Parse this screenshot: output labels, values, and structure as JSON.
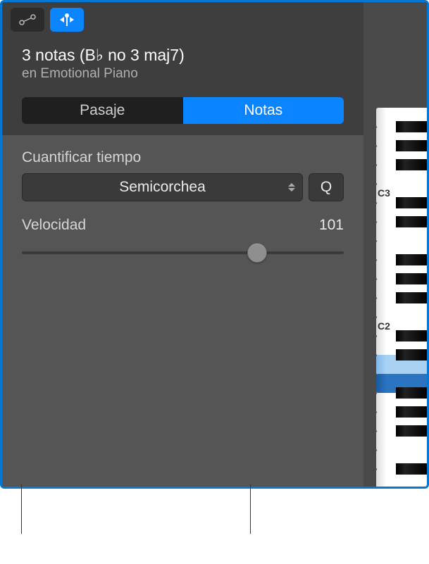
{
  "header": {
    "title": "3 notas (B♭ no 3 maj7)",
    "subtitle": "en Emotional Piano"
  },
  "tabs": {
    "pasaje": "Pasaje",
    "notas": "Notas"
  },
  "quantize": {
    "label": "Cuantificar tiempo",
    "selected": "Semicorchea",
    "button": "Q"
  },
  "velocity": {
    "label": "Velocidad",
    "value": "101",
    "slider_percent": 73
  },
  "piano": {
    "c3_label": "C3",
    "c2_label": "C2",
    "octaves": [
      {
        "c_label": "C3",
        "highlight_white": [],
        "highlight_black": []
      },
      {
        "c_label": "C2",
        "highlight_white": [],
        "highlight_black": []
      }
    ],
    "white_count": 20,
    "highlight_indices": {
      "light": 13,
      "dark": 14
    }
  },
  "icons": {
    "automation": "automation-icon",
    "catch": "catch-icon"
  }
}
